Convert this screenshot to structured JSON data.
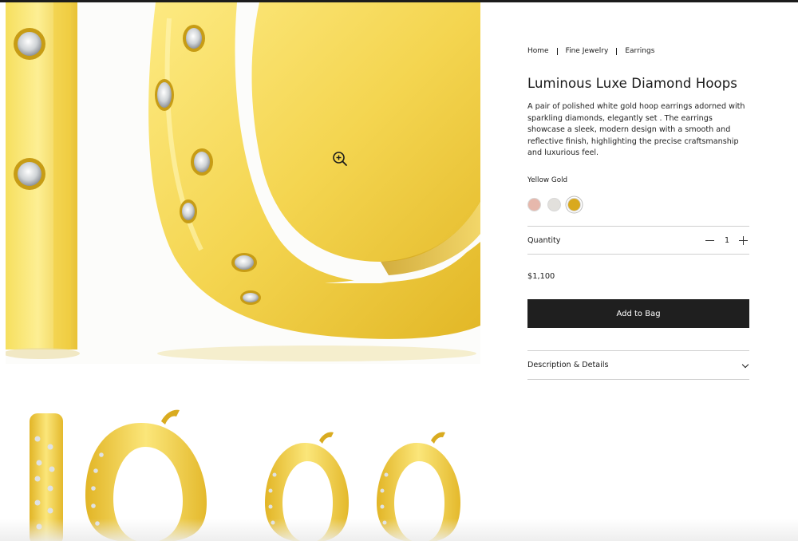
{
  "breadcrumb": [
    "Home",
    "Fine Jewelry",
    "Earrings"
  ],
  "product": {
    "title": "Luminous Luxe Diamond Hoops",
    "description": "A pair of polished white gold hoop earrings adorned with sparkling diamonds, elegantly set . The earrings showcase a sleek, modern design with a smooth and reflective finish, highlighting the precise craftsmanship and luxurious feel.",
    "selected_color_label": "Yellow Gold",
    "swatches": [
      {
        "name": "Rose Gold",
        "color": "#e6b8ac"
      },
      {
        "name": "White Gold",
        "color": "#e2e0dc"
      },
      {
        "name": "Yellow Gold",
        "color": "#d9a91e",
        "selected": true
      }
    ],
    "quantity_label": "Quantity",
    "quantity": "1",
    "price": "$1,100",
    "add_to_bag_label": "Add to Bag",
    "details_label": "Description & Details"
  },
  "colors": {
    "gold_light": "#fbe87c",
    "gold_mid": "#f0cf3f",
    "gold_dark": "#c99c12",
    "button_bg": "#1f1f1f"
  },
  "icons": {
    "zoom": "zoom-in-icon",
    "qty_minus": "minus-icon",
    "qty_plus": "plus-icon",
    "details": "chevron-down-icon"
  }
}
